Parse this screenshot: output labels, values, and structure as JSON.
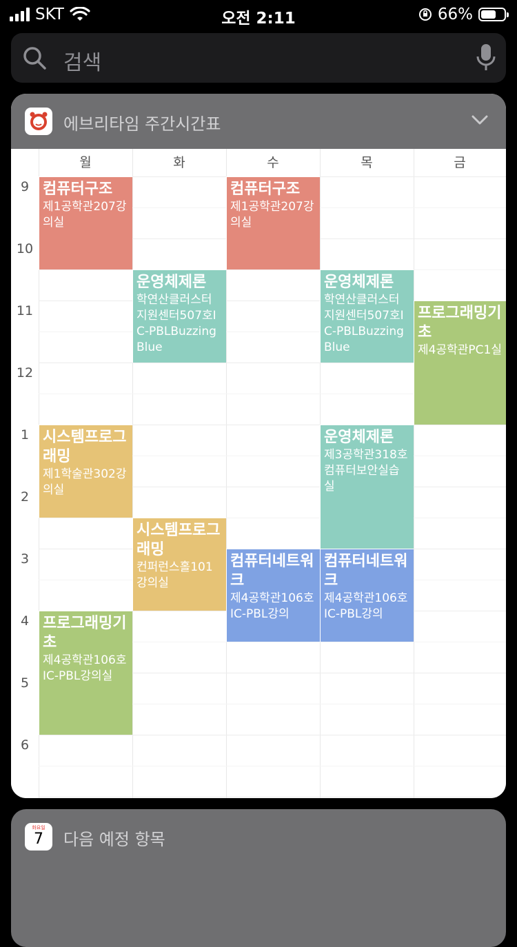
{
  "status_bar": {
    "carrier": "SKT",
    "time": "오전 2:11",
    "battery_percent": "66%",
    "battery_level": 0.66
  },
  "search": {
    "placeholder": "검색"
  },
  "timetable_widget": {
    "title": "에브리타임 주간시간표",
    "days": [
      "월",
      "화",
      "수",
      "목",
      "금"
    ],
    "hours": [
      "9",
      "10",
      "11",
      "12",
      "1",
      "2",
      "3",
      "4",
      "5",
      "6"
    ],
    "events": [
      {
        "day": 0,
        "start": 9.0,
        "end": 10.5,
        "title": "컴퓨터구조",
        "location": "제1공학관207강의실",
        "color": "#e3897b"
      },
      {
        "day": 2,
        "start": 9.0,
        "end": 10.5,
        "title": "컴퓨터구조",
        "location": "제1공학관207강의실",
        "color": "#e3897b"
      },
      {
        "day": 1,
        "start": 10.5,
        "end": 12.0,
        "title": "운영체제론",
        "location": "학연산클러스터지원센터507호IC-PBLBuzzingBlue",
        "color": "#8ecfc0"
      },
      {
        "day": 3,
        "start": 10.5,
        "end": 12.0,
        "title": "운영체제론",
        "location": "학연산클러스터지원센터507호IC-PBLBuzzingBlue",
        "color": "#8ecfc0"
      },
      {
        "day": 4,
        "start": 11.0,
        "end": 13.0,
        "title": "프로그래밍기초",
        "location": "제4공학관PC1실",
        "color": "#abc97a"
      },
      {
        "day": 0,
        "start": 13.0,
        "end": 14.5,
        "title": "시스템프로그래밍",
        "location": "제1학술관302강의실",
        "color": "#e6c376"
      },
      {
        "day": 3,
        "start": 13.0,
        "end": 15.0,
        "title": "운영체제론",
        "location": "제3공학관318호컴퓨터보안실습실",
        "color": "#8ecfc0"
      },
      {
        "day": 1,
        "start": 14.5,
        "end": 16.0,
        "title": "시스템프로그래밍",
        "location": "컨퍼런스홀101강의실",
        "color": "#e6c376"
      },
      {
        "day": 2,
        "start": 15.0,
        "end": 16.5,
        "title": "컴퓨터네트워크",
        "location": "제4공학관106호IC-PBL강의",
        "color": "#7fa2e3"
      },
      {
        "day": 3,
        "start": 15.0,
        "end": 16.5,
        "title": "컴퓨터네트워크",
        "location": "제4공학관106호IC-PBL강의",
        "color": "#7fa2e3"
      },
      {
        "day": 0,
        "start": 16.0,
        "end": 18.0,
        "title": "프로그래밍기초",
        "location": "제4공학관106호IC-PBL강의실",
        "color": "#abc97a"
      }
    ]
  },
  "upcoming_widget": {
    "title": "다음 예정 항목",
    "calendar_weekday": "화요일",
    "calendar_day": "7"
  }
}
